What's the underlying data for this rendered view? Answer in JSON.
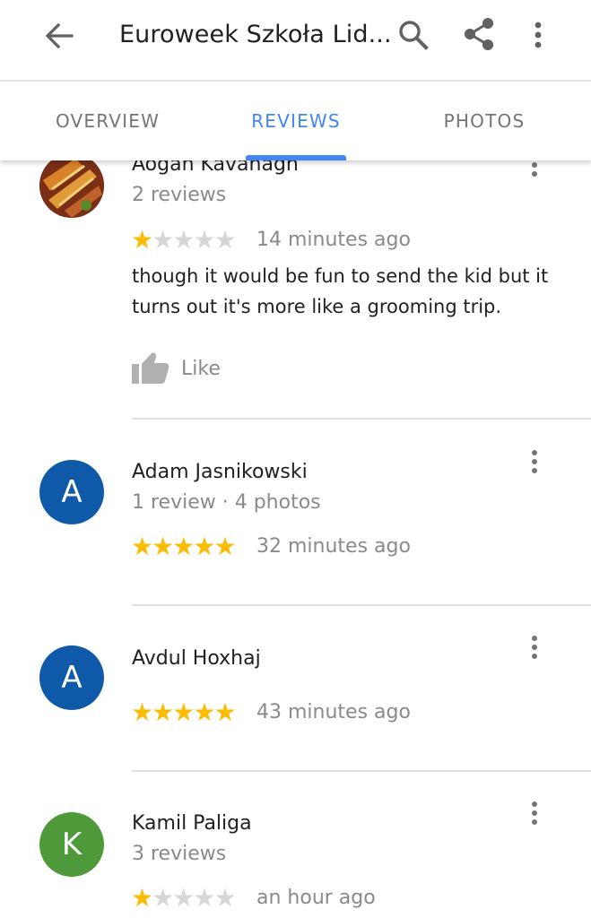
{
  "appbar": {
    "title": "Euroweek Szkoła Lid...",
    "icons": [
      "arrow-back-icon",
      "search-icon",
      "share-icon",
      "more-vert-icon"
    ]
  },
  "tabs": [
    {
      "label": "OVERVIEW",
      "active": false
    },
    {
      "label": "REVIEWS",
      "active": true
    },
    {
      "label": "PHOTOS",
      "active": false
    }
  ],
  "colors": {
    "accent": "#4285f4",
    "star": "#fbbc04",
    "avatar_blue": "#0e5aa8",
    "avatar_green": "#4e9a3a"
  },
  "reviews": [
    {
      "name": "Aogan Kavanagh",
      "meta": "2 reviews",
      "rating": 1,
      "time": "14 minutes ago",
      "text": "though it would be fun to send the kid but it turns out it's more like a grooming trip.",
      "like_label": "Like",
      "avatar": "photo"
    },
    {
      "name": "Adam Jasnikowski",
      "meta": "1 review · 4 photos",
      "rating": 5,
      "time": "32 minutes ago",
      "avatar_letter": "A"
    },
    {
      "name": "Avdul Hoxhaj",
      "meta": "",
      "rating": 5,
      "time": "43 minutes ago",
      "avatar_letter": "A"
    },
    {
      "name": "Kamil Paliga",
      "meta": "3 reviews",
      "rating": 1,
      "time": "an hour ago",
      "avatar_letter": "K"
    }
  ]
}
